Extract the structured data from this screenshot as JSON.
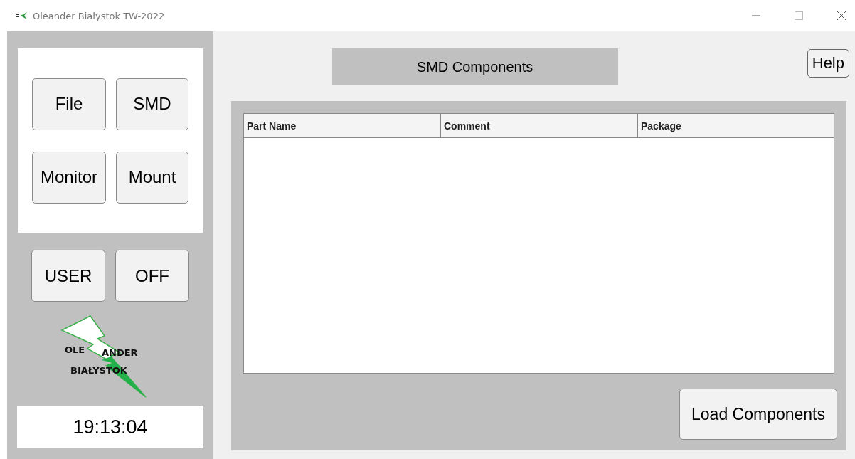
{
  "window": {
    "title": "Oleander Białystok TW-2022"
  },
  "nav_buttons": [
    "File",
    "SMD",
    "Monitor",
    "Mount"
  ],
  "session_buttons": [
    "USER",
    "OFF"
  ],
  "logo": {
    "words": [
      "OLE",
      "ANDER",
      "BIAŁYSTOK"
    ]
  },
  "clock": "19:13:04",
  "header": "SMD Components",
  "help_button": "Help",
  "table": {
    "columns": [
      "Part Name",
      "Comment",
      "Package"
    ]
  },
  "load_button": "Load Components"
}
